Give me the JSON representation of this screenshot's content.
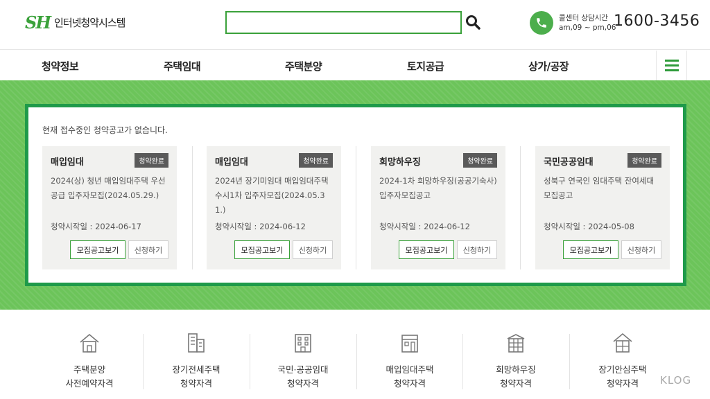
{
  "header": {
    "logo_mark_s": "S",
    "logo_mark_h": "H",
    "logo_text": "인터넷청약시스템",
    "search_placeholder": "",
    "call_line1": "콜센터 상담시간",
    "call_line2": "am,09 ~ pm,06",
    "call_number": "1600-3456"
  },
  "nav": {
    "items": [
      "청약정보",
      "주택임대",
      "주택분양",
      "토지공급",
      "상가/공장"
    ]
  },
  "notice": {
    "message": "현재 접수중인 청약공고가 없습니다.",
    "cards": [
      {
        "title": "매입임대",
        "badge": "청약완료",
        "desc": "2024(상) 청년 매입임대주택 우선공급 입주자모집(2024.05.29.)",
        "date": "청약시작일 : 2024-06-17",
        "view_label": "모집공고보기",
        "apply_label": "신청하기"
      },
      {
        "title": "매입임대",
        "badge": "청약완료",
        "desc": "2024년 장기미임대 매입임대주택 수시1차 입주자모집(2024.05.31.)",
        "date": "청약시작일 : 2024-06-12",
        "view_label": "모집공고보기",
        "apply_label": "신청하기"
      },
      {
        "title": "희망하우징",
        "badge": "청약완료",
        "desc": "2024-1차 희망하우징(공공기숙사) 입주자모집공고",
        "date": "청약시작일 : 2024-06-12",
        "view_label": "모집공고보기",
        "apply_label": "신청하기"
      },
      {
        "title": "국민공공임대",
        "badge": "청약완료",
        "desc": "성북구 연국인 임대주택 잔여세대 모집공고",
        "date": "청약시작일 : 2024-05-08",
        "view_label": "모집공고보기",
        "apply_label": "신청하기"
      }
    ]
  },
  "qualifications": [
    {
      "icon": "house-icon",
      "line1": "주택분양",
      "line2": "사전예약자격"
    },
    {
      "icon": "apartment-icon",
      "line1": "장기전세주택",
      "line2": "청약자격"
    },
    {
      "icon": "building-icon",
      "line1": "국민·공공임대",
      "line2": "청약자격"
    },
    {
      "icon": "store-building-icon",
      "line1": "매입임대주택",
      "line2": "청약자격"
    },
    {
      "icon": "dormitory-icon",
      "line1": "희망하우징",
      "line2": "청약자격"
    },
    {
      "icon": "home-safe-icon",
      "line1": "장기안심주택",
      "line2": "청약자격"
    }
  ],
  "watermark": "KLOG",
  "colors": {
    "brand_green": "#3aa13a",
    "banner_green": "#6cc45a",
    "panel_border": "#1f9a4a",
    "badge_gray": "#5a5a5a"
  }
}
